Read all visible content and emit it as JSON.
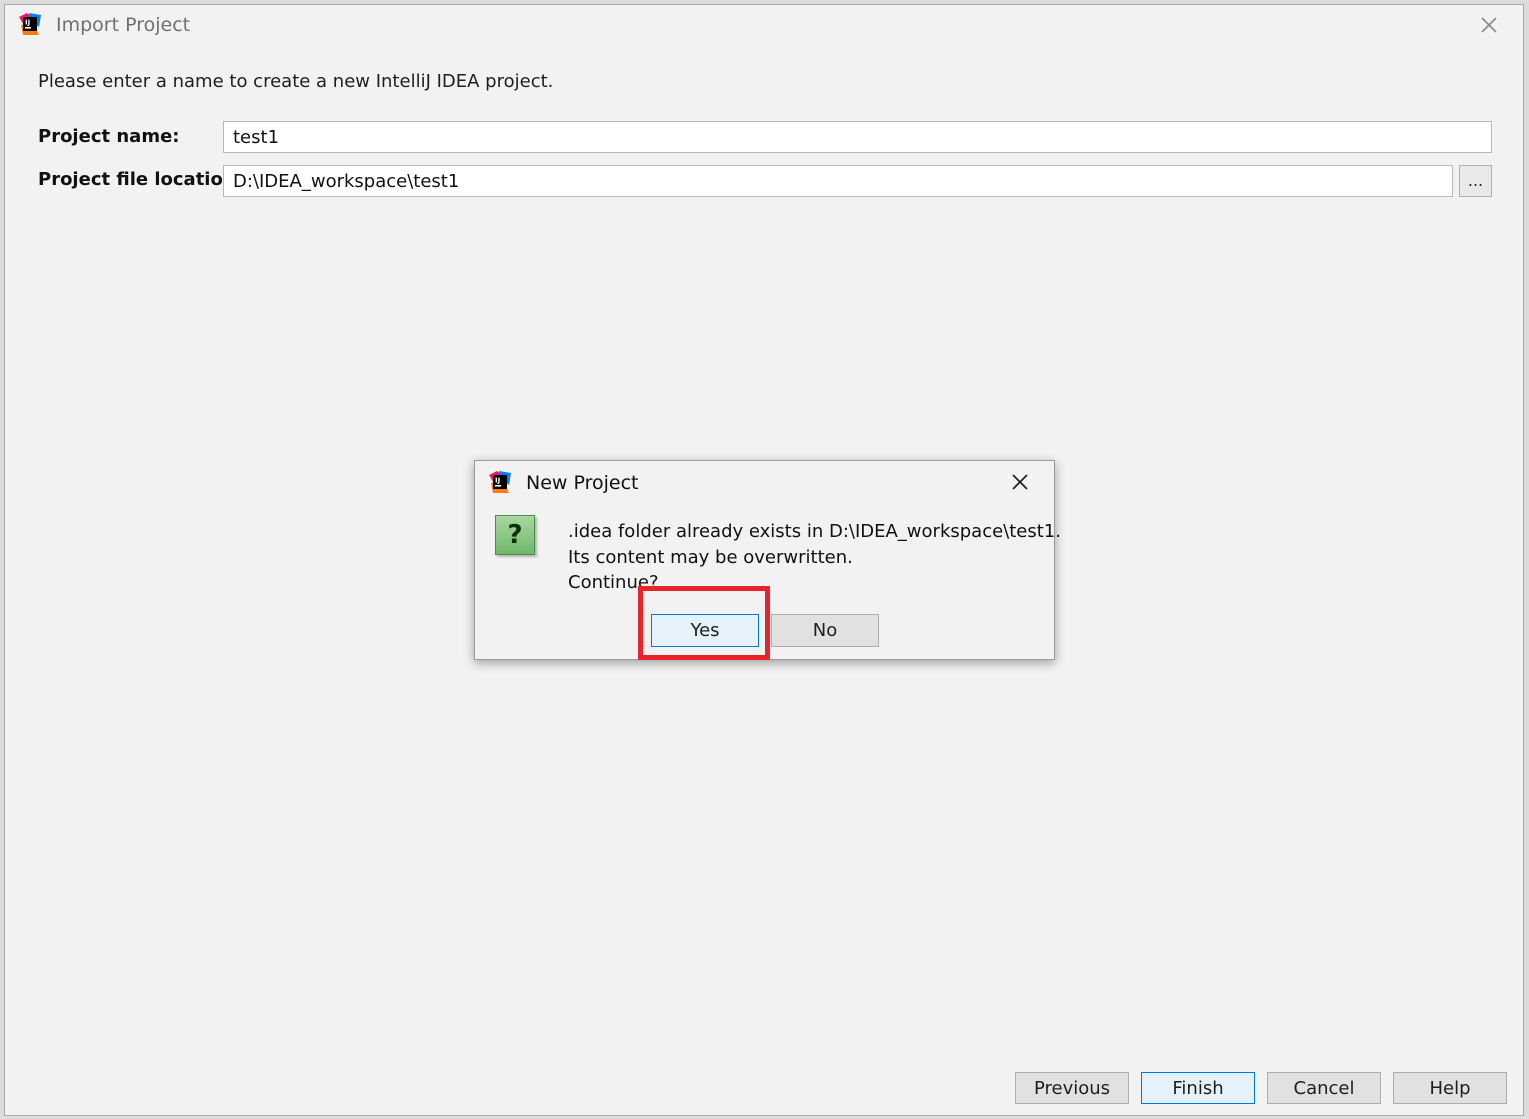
{
  "window": {
    "title": "Import Project"
  },
  "form": {
    "intro": "Please enter a name to create a new IntelliJ IDEA project.",
    "project_name_label": "Project name:",
    "project_name_value": "test1",
    "project_location_label": "Project file location:",
    "project_location_value": "D:\\IDEA_workspace\\test1",
    "browse_label": "..."
  },
  "footer": {
    "previous": "Previous",
    "finish": "Finish",
    "cancel": "Cancel",
    "help": "Help"
  },
  "dialog": {
    "title": "New Project",
    "icon": "question-icon",
    "icon_glyph": "?",
    "message_lines": [
      ".idea folder already exists in D:\\IDEA_workspace\\test1.",
      "Its content may be overwritten.",
      "Continue?"
    ],
    "yes": "Yes",
    "no": "No"
  },
  "colors": {
    "highlight": "#e8232a",
    "primary_border": "#0078d7"
  }
}
